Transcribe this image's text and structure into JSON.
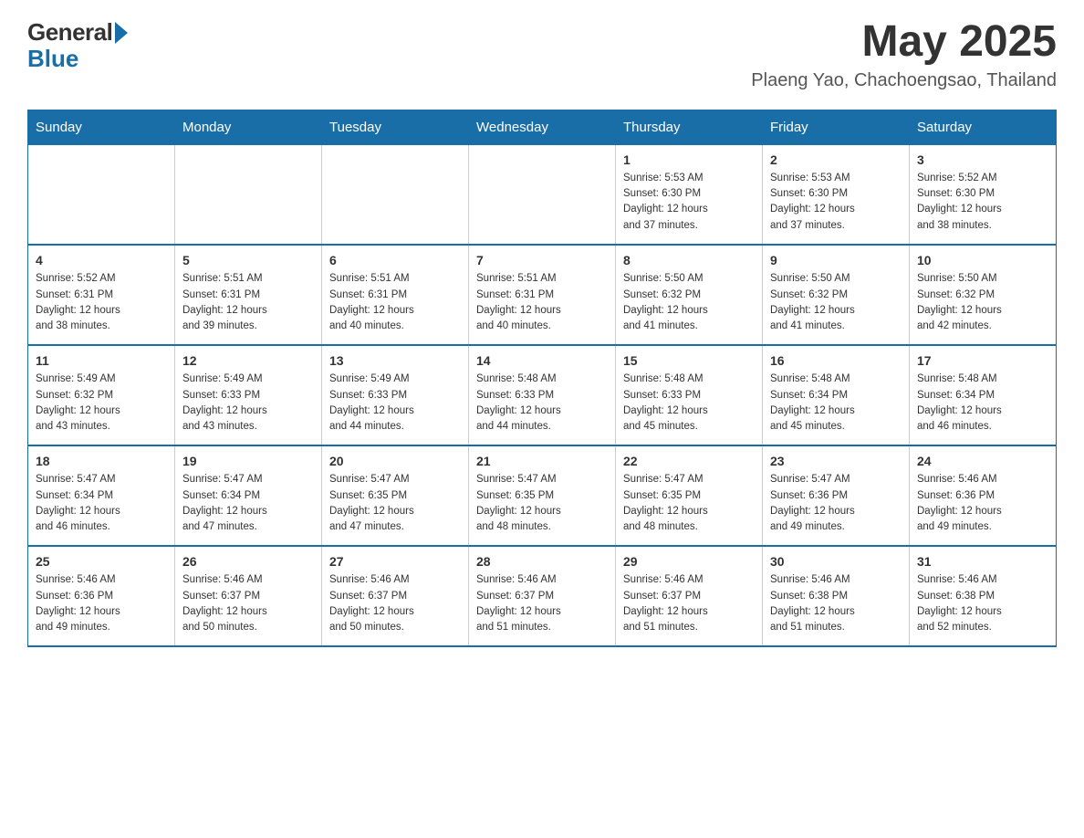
{
  "header": {
    "logo_general": "General",
    "logo_blue": "Blue",
    "month_title": "May 2025",
    "location": "Plaeng Yao, Chachoengsao, Thailand"
  },
  "weekdays": [
    "Sunday",
    "Monday",
    "Tuesday",
    "Wednesday",
    "Thursday",
    "Friday",
    "Saturday"
  ],
  "weeks": [
    [
      {
        "day": "",
        "info": ""
      },
      {
        "day": "",
        "info": ""
      },
      {
        "day": "",
        "info": ""
      },
      {
        "day": "",
        "info": ""
      },
      {
        "day": "1",
        "info": "Sunrise: 5:53 AM\nSunset: 6:30 PM\nDaylight: 12 hours\nand 37 minutes."
      },
      {
        "day": "2",
        "info": "Sunrise: 5:53 AM\nSunset: 6:30 PM\nDaylight: 12 hours\nand 37 minutes."
      },
      {
        "day": "3",
        "info": "Sunrise: 5:52 AM\nSunset: 6:30 PM\nDaylight: 12 hours\nand 38 minutes."
      }
    ],
    [
      {
        "day": "4",
        "info": "Sunrise: 5:52 AM\nSunset: 6:31 PM\nDaylight: 12 hours\nand 38 minutes."
      },
      {
        "day": "5",
        "info": "Sunrise: 5:51 AM\nSunset: 6:31 PM\nDaylight: 12 hours\nand 39 minutes."
      },
      {
        "day": "6",
        "info": "Sunrise: 5:51 AM\nSunset: 6:31 PM\nDaylight: 12 hours\nand 40 minutes."
      },
      {
        "day": "7",
        "info": "Sunrise: 5:51 AM\nSunset: 6:31 PM\nDaylight: 12 hours\nand 40 minutes."
      },
      {
        "day": "8",
        "info": "Sunrise: 5:50 AM\nSunset: 6:32 PM\nDaylight: 12 hours\nand 41 minutes."
      },
      {
        "day": "9",
        "info": "Sunrise: 5:50 AM\nSunset: 6:32 PM\nDaylight: 12 hours\nand 41 minutes."
      },
      {
        "day": "10",
        "info": "Sunrise: 5:50 AM\nSunset: 6:32 PM\nDaylight: 12 hours\nand 42 minutes."
      }
    ],
    [
      {
        "day": "11",
        "info": "Sunrise: 5:49 AM\nSunset: 6:32 PM\nDaylight: 12 hours\nand 43 minutes."
      },
      {
        "day": "12",
        "info": "Sunrise: 5:49 AM\nSunset: 6:33 PM\nDaylight: 12 hours\nand 43 minutes."
      },
      {
        "day": "13",
        "info": "Sunrise: 5:49 AM\nSunset: 6:33 PM\nDaylight: 12 hours\nand 44 minutes."
      },
      {
        "day": "14",
        "info": "Sunrise: 5:48 AM\nSunset: 6:33 PM\nDaylight: 12 hours\nand 44 minutes."
      },
      {
        "day": "15",
        "info": "Sunrise: 5:48 AM\nSunset: 6:33 PM\nDaylight: 12 hours\nand 45 minutes."
      },
      {
        "day": "16",
        "info": "Sunrise: 5:48 AM\nSunset: 6:34 PM\nDaylight: 12 hours\nand 45 minutes."
      },
      {
        "day": "17",
        "info": "Sunrise: 5:48 AM\nSunset: 6:34 PM\nDaylight: 12 hours\nand 46 minutes."
      }
    ],
    [
      {
        "day": "18",
        "info": "Sunrise: 5:47 AM\nSunset: 6:34 PM\nDaylight: 12 hours\nand 46 minutes."
      },
      {
        "day": "19",
        "info": "Sunrise: 5:47 AM\nSunset: 6:34 PM\nDaylight: 12 hours\nand 47 minutes."
      },
      {
        "day": "20",
        "info": "Sunrise: 5:47 AM\nSunset: 6:35 PM\nDaylight: 12 hours\nand 47 minutes."
      },
      {
        "day": "21",
        "info": "Sunrise: 5:47 AM\nSunset: 6:35 PM\nDaylight: 12 hours\nand 48 minutes."
      },
      {
        "day": "22",
        "info": "Sunrise: 5:47 AM\nSunset: 6:35 PM\nDaylight: 12 hours\nand 48 minutes."
      },
      {
        "day": "23",
        "info": "Sunrise: 5:47 AM\nSunset: 6:36 PM\nDaylight: 12 hours\nand 49 minutes."
      },
      {
        "day": "24",
        "info": "Sunrise: 5:46 AM\nSunset: 6:36 PM\nDaylight: 12 hours\nand 49 minutes."
      }
    ],
    [
      {
        "day": "25",
        "info": "Sunrise: 5:46 AM\nSunset: 6:36 PM\nDaylight: 12 hours\nand 49 minutes."
      },
      {
        "day": "26",
        "info": "Sunrise: 5:46 AM\nSunset: 6:37 PM\nDaylight: 12 hours\nand 50 minutes."
      },
      {
        "day": "27",
        "info": "Sunrise: 5:46 AM\nSunset: 6:37 PM\nDaylight: 12 hours\nand 50 minutes."
      },
      {
        "day": "28",
        "info": "Sunrise: 5:46 AM\nSunset: 6:37 PM\nDaylight: 12 hours\nand 51 minutes."
      },
      {
        "day": "29",
        "info": "Sunrise: 5:46 AM\nSunset: 6:37 PM\nDaylight: 12 hours\nand 51 minutes."
      },
      {
        "day": "30",
        "info": "Sunrise: 5:46 AM\nSunset: 6:38 PM\nDaylight: 12 hours\nand 51 minutes."
      },
      {
        "day": "31",
        "info": "Sunrise: 5:46 AM\nSunset: 6:38 PM\nDaylight: 12 hours\nand 52 minutes."
      }
    ]
  ]
}
